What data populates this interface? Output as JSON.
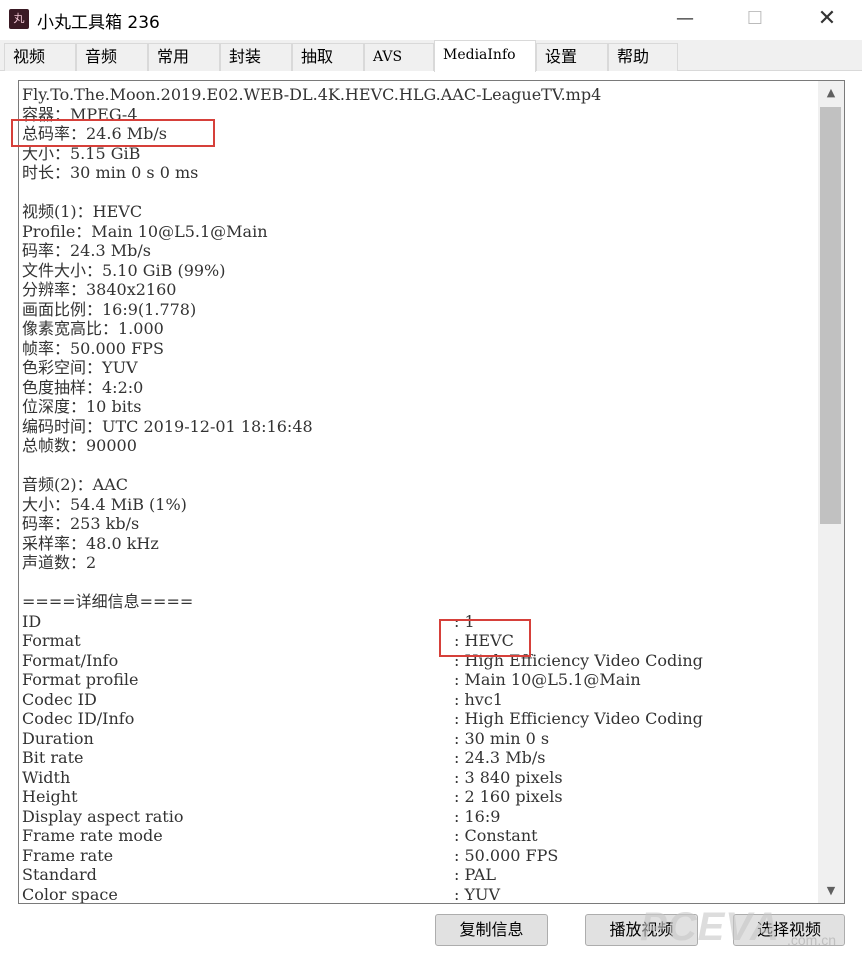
{
  "window": {
    "title": "小丸工具箱 236",
    "icon_text": "丸",
    "minimize": "—",
    "maximize": "☐",
    "close": "✕"
  },
  "tabs": [
    {
      "label": "视频"
    },
    {
      "label": "音频"
    },
    {
      "label": "常用"
    },
    {
      "label": "封装"
    },
    {
      "label": "抽取"
    },
    {
      "label": "AVS"
    },
    {
      "label": "MediaInfo",
      "active": true
    },
    {
      "label": "设置"
    },
    {
      "label": "帮助"
    }
  ],
  "summary": {
    "filename": "Fly.To.The.Moon.2019.E02.WEB-DL.4K.HEVC.HLG.AAC-LeagueTV.mp4",
    "container": "容器：MPEG-4",
    "total_bitrate": "总码率：24.6 Mb/s",
    "size": "大小：5.15 GiB",
    "duration": "时长：30 min 0 s 0 ms"
  },
  "video": {
    "header": "视频(1)：HEVC",
    "profile": "Profile：Main 10@L5.1@Main",
    "bitrate": "码率：24.3 Mb/s",
    "filesize": "文件大小：5.10 GiB (99%)",
    "resolution": "分辨率：3840x2160",
    "aspect": "画面比例：16:9(1.778)",
    "pixel_aspect": "像素宽高比：1.000",
    "fps": "帧率：50.000 FPS",
    "colorspace": "色彩空间：YUV",
    "chroma": "色度抽样：4:2:0",
    "bitdepth": "位深度：10 bits",
    "encoded": "编码时间：UTC 2019-12-01 18:16:48",
    "frames": "总帧数：90000"
  },
  "audio": {
    "header": "音频(2)：AAC",
    "size": "大小：54.4 MiB (1%)",
    "bitrate": "码率：253 kb/s",
    "samplerate": "采样率：48.0 kHz",
    "channels": "声道数：2"
  },
  "details": {
    "header": "====详细信息====",
    "rows": [
      {
        "key": "ID",
        "value": ": 1"
      },
      {
        "key": "Format",
        "value": ": HEVC"
      },
      {
        "key": "Format/Info",
        "value": ": High Efficiency Video Coding"
      },
      {
        "key": "Format profile",
        "value": ": Main 10@L5.1@Main"
      },
      {
        "key": "Codec ID",
        "value": ": hvc1"
      },
      {
        "key": "Codec ID/Info",
        "value": ": High Efficiency Video Coding"
      },
      {
        "key": "Duration",
        "value": ": 30 min 0 s"
      },
      {
        "key": "Bit rate",
        "value": ": 24.3 Mb/s"
      },
      {
        "key": "Width",
        "value": ": 3 840 pixels"
      },
      {
        "key": "Height",
        "value": ": 2 160 pixels"
      },
      {
        "key": "Display aspect ratio",
        "value": ": 16:9"
      },
      {
        "key": "Frame rate mode",
        "value": ": Constant"
      },
      {
        "key": "Frame rate",
        "value": ": 50.000 FPS"
      },
      {
        "key": "Standard",
        "value": ": PAL"
      },
      {
        "key": "Color space",
        "value": ": YUV"
      }
    ]
  },
  "scrollbar": {
    "up": "▲",
    "down": "▼"
  },
  "buttons": {
    "copy": "复制信息",
    "play": "播放视频",
    "select": "选择视频"
  },
  "watermark": {
    "main": "PCEVA",
    "sub": ".com.cn"
  },
  "colors": {
    "highlight": "#d6403a"
  }
}
